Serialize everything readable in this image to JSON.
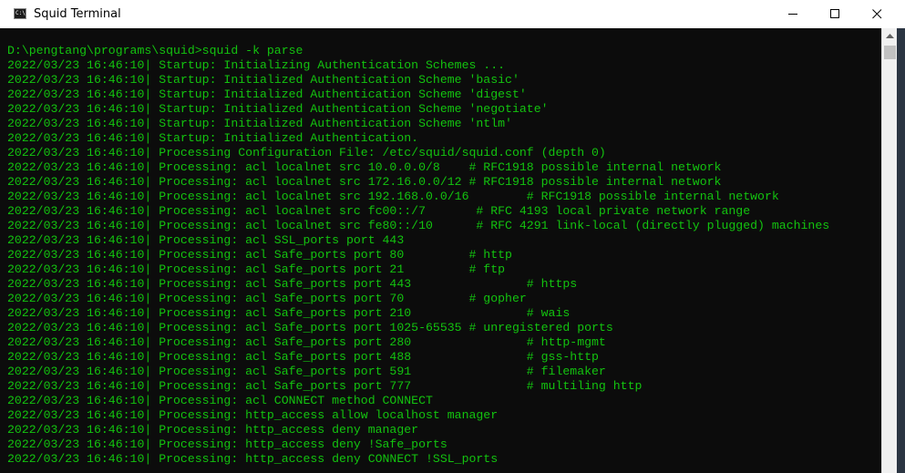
{
  "window": {
    "title": "Squid Terminal",
    "icon": "console-icon",
    "icon_text": "C:\\."
  },
  "controls": {
    "minimize": "minimize-icon",
    "maximize": "maximize-icon",
    "close": "close-icon"
  },
  "colors": {
    "console_bg": "#0c0c0c",
    "console_text": "#13c30f",
    "titlebar_bg": "#ffffff"
  },
  "console": {
    "lines": [
      "D:\\pengtang\\programs\\squid>squid -k parse",
      "2022/03/23 16:46:10| Startup: Initializing Authentication Schemes ...",
      "2022/03/23 16:46:10| Startup: Initialized Authentication Scheme 'basic'",
      "2022/03/23 16:46:10| Startup: Initialized Authentication Scheme 'digest'",
      "2022/03/23 16:46:10| Startup: Initialized Authentication Scheme 'negotiate'",
      "2022/03/23 16:46:10| Startup: Initialized Authentication Scheme 'ntlm'",
      "2022/03/23 16:46:10| Startup: Initialized Authentication.",
      "2022/03/23 16:46:10| Processing Configuration File: /etc/squid/squid.conf (depth 0)",
      "2022/03/23 16:46:10| Processing: acl localnet src 10.0.0.0/8    # RFC1918 possible internal network",
      "2022/03/23 16:46:10| Processing: acl localnet src 172.16.0.0/12 # RFC1918 possible internal network",
      "2022/03/23 16:46:10| Processing: acl localnet src 192.168.0.0/16        # RFC1918 possible internal network",
      "2022/03/23 16:46:10| Processing: acl localnet src fc00::/7       # RFC 4193 local private network range",
      "2022/03/23 16:46:10| Processing: acl localnet src fe80::/10      # RFC 4291 link-local (directly plugged) machines",
      "2022/03/23 16:46:10| Processing: acl SSL_ports port 443",
      "2022/03/23 16:46:10| Processing: acl Safe_ports port 80         # http",
      "2022/03/23 16:46:10| Processing: acl Safe_ports port 21         # ftp",
      "2022/03/23 16:46:10| Processing: acl Safe_ports port 443                # https",
      "2022/03/23 16:46:10| Processing: acl Safe_ports port 70         # gopher",
      "2022/03/23 16:46:10| Processing: acl Safe_ports port 210                # wais",
      "2022/03/23 16:46:10| Processing: acl Safe_ports port 1025-65535 # unregistered ports",
      "2022/03/23 16:46:10| Processing: acl Safe_ports port 280                # http-mgmt",
      "2022/03/23 16:46:10| Processing: acl Safe_ports port 488                # gss-http",
      "2022/03/23 16:46:10| Processing: acl Safe_ports port 591                # filemaker",
      "2022/03/23 16:46:10| Processing: acl Safe_ports port 777                # multiling http",
      "2022/03/23 16:46:10| Processing: acl CONNECT method CONNECT",
      "2022/03/23 16:46:10| Processing: http_access allow localhost manager",
      "2022/03/23 16:46:10| Processing: http_access deny manager",
      "2022/03/23 16:46:10| Processing: http_access deny !Safe_ports",
      "2022/03/23 16:46:10| Processing: http_access deny CONNECT !SSL_ports"
    ]
  }
}
